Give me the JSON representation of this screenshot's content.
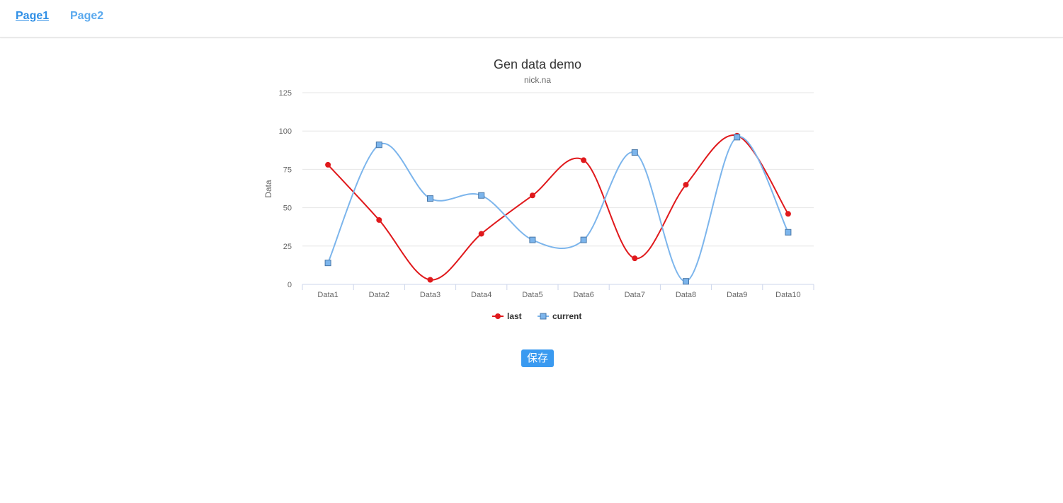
{
  "nav": {
    "items": [
      {
        "label": "Page1",
        "active": true
      },
      {
        "label": "Page2",
        "active": false
      }
    ]
  },
  "chart_data": {
    "type": "line",
    "title": "Gen data demo",
    "subtitle": "nick.na",
    "ylabel": "Data",
    "xlabel": "",
    "categories": [
      "Data1",
      "Data2",
      "Data3",
      "Data4",
      "Data5",
      "Data6",
      "Data7",
      "Data8",
      "Data9",
      "Data10"
    ],
    "series": [
      {
        "name": "last",
        "color": "#e0191c",
        "marker": "circle",
        "values": [
          78,
          42,
          3,
          33,
          58,
          81,
          17,
          65,
          97,
          46
        ]
      },
      {
        "name": "current",
        "color": "#7cb5ec",
        "marker": "square",
        "values": [
          14,
          91,
          56,
          58,
          29,
          29,
          86,
          2,
          96,
          34
        ]
      }
    ],
    "yticks": [
      0,
      25,
      50,
      75,
      100,
      125
    ],
    "ylim": [
      0,
      125
    ],
    "grid": true,
    "legend": "bottom-center"
  },
  "save_button": {
    "label": "保存",
    "color": "#3a9af0"
  }
}
